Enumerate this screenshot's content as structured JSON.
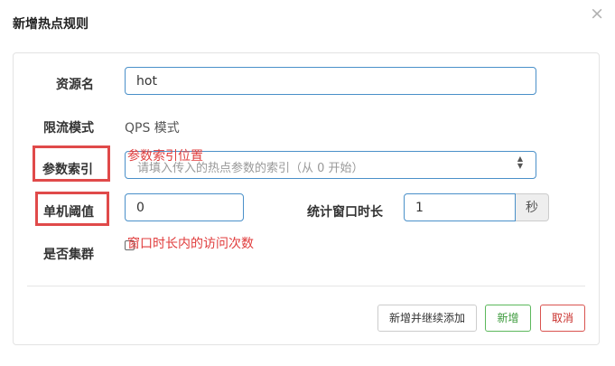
{
  "dialog": {
    "title": "新增热点规则",
    "close_icon": "close-icon"
  },
  "form": {
    "resource_name": {
      "label": "资源名",
      "value": "hot"
    },
    "limit_mode": {
      "label": "限流模式",
      "value": "QPS 模式"
    },
    "param_index": {
      "label": "参数索引",
      "placeholder": "请填入传入的热点参数的索引（从 0 开始）",
      "annotation": "参数索引位置"
    },
    "threshold": {
      "label": "单机阈值",
      "value": "0",
      "annotation": "窗口时长内的访问次数"
    },
    "stat_window": {
      "label": "统计窗口时长",
      "value": "1",
      "unit": "秒"
    },
    "cluster": {
      "label": "是否集群",
      "checked": false
    }
  },
  "footer": {
    "add_continue_label": "新增并继续添加",
    "add_label": "新增",
    "cancel_label": "取消"
  },
  "colors": {
    "accent_border": "#4a90c9",
    "annotation_red": "#e03c3c",
    "success": "#5cb85c",
    "danger": "#d9534f"
  }
}
